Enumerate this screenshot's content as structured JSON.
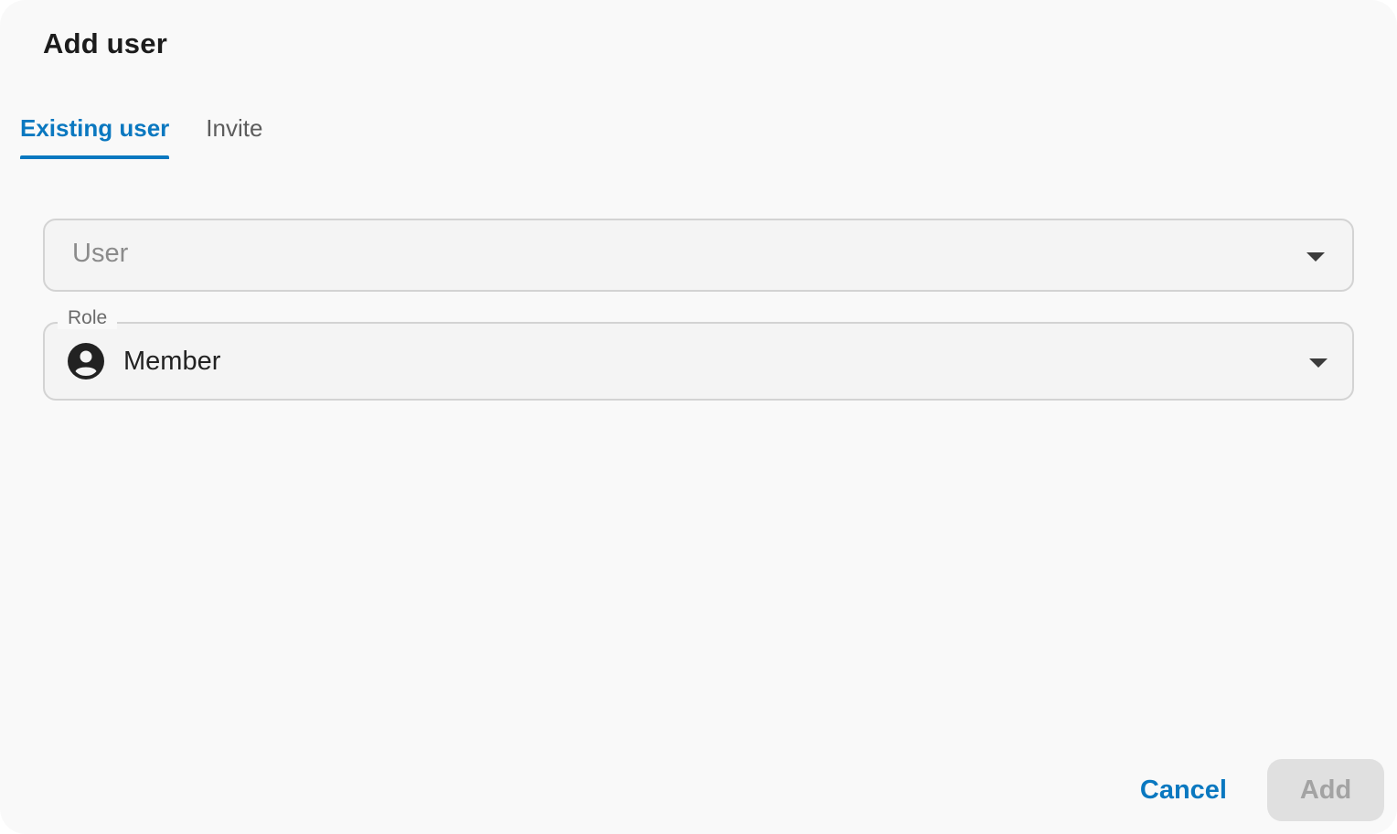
{
  "dialog": {
    "title": "Add user"
  },
  "tabs": [
    {
      "label": "Existing user",
      "active": true
    },
    {
      "label": "Invite",
      "active": false
    }
  ],
  "user_field": {
    "placeholder": "User",
    "value": ""
  },
  "role_field": {
    "label": "Role",
    "value": "Member",
    "icon": "account-circle-icon"
  },
  "actions": {
    "cancel_label": "Cancel",
    "add_label": "Add",
    "add_enabled": false
  },
  "colors": {
    "accent": "#0a78c0",
    "background": "#f9f9f9",
    "field_border": "#d3d3d3",
    "disabled_bg": "#e0e0e0",
    "disabled_text": "#a3a3a3"
  }
}
